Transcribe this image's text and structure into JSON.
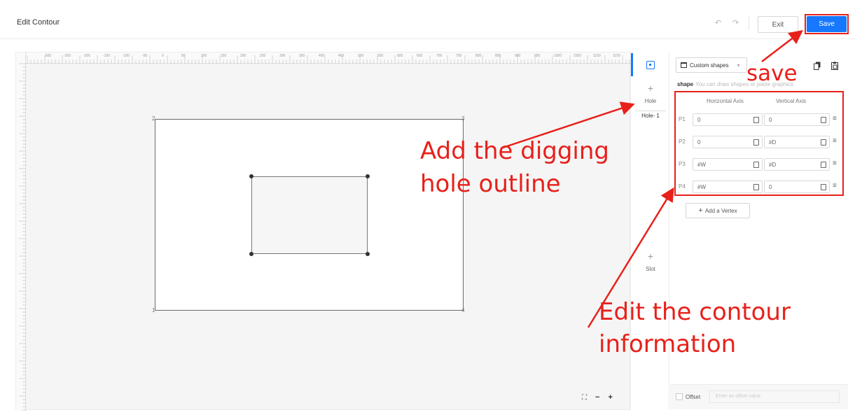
{
  "header": {
    "title": "Edit Contour",
    "undo_icon": "undo-icon",
    "redo_icon": "redo-icon",
    "exit_label": "Exit",
    "save_label": "Save"
  },
  "canvas": {
    "ruler_top_labels": [
      "-300",
      "-250",
      "-200",
      "-150",
      "-100",
      "-50",
      "0",
      "50",
      "100",
      "150",
      "200",
      "250",
      "300",
      "350",
      "400",
      "450",
      "500",
      "550",
      "600",
      "650",
      "700",
      "750",
      "800",
      "850",
      "900",
      "950",
      "1000",
      "1050",
      "1100",
      "1150",
      "1200"
    ],
    "corner_labels": [
      "1",
      "2",
      "3",
      "4"
    ]
  },
  "strip": {
    "hole_label": "Hole",
    "hole_item": "Hole- 1",
    "slot_label": "Slot"
  },
  "panel": {
    "shape_select": "Custom shapes",
    "shape_title": "shape",
    "shape_hint": "You can draw shapes or paste graphics",
    "col_horizontal": "Horizontal Axis",
    "col_vertical": "Vertical Axis",
    "vertices": [
      {
        "label": "P1",
        "h": "0",
        "v": "0"
      },
      {
        "label": "P2",
        "h": "0",
        "v": "#D"
      },
      {
        "label": "P3",
        "h": "#W",
        "v": "#D"
      },
      {
        "label": "P4",
        "h": "#W",
        "v": "0"
      }
    ],
    "add_vertex_label": "Add a Vertex",
    "offset_label": "Offset",
    "offset_placeholder": "Enter an offset value"
  },
  "annotations": {
    "save": "save",
    "hole_line1": "Add the digging",
    "hole_line2": "hole outline",
    "edit_line1": "Edit the contour",
    "edit_line2": "information"
  },
  "colors": {
    "accent": "#1677ff",
    "annotation": "#e8201a"
  }
}
